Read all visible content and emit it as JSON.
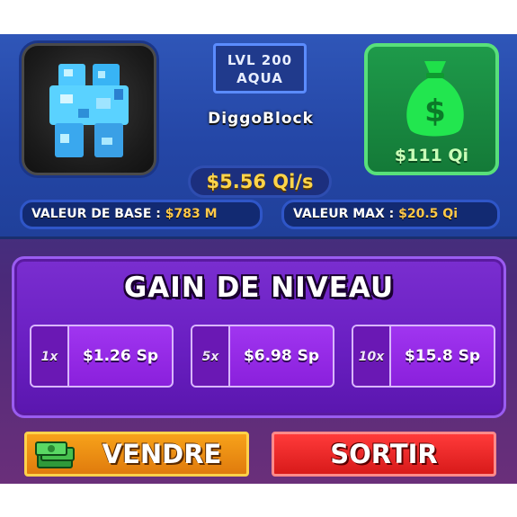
{
  "item": {
    "level": "LVL 200",
    "variant": "AQUA",
    "name": "DiggoBlock",
    "rate": "$5.56 Qi/s",
    "icon": "diamond-block-creature-icon"
  },
  "cash": {
    "amount": "$111 Qi",
    "icon": "money-bag-icon",
    "color": "#1e9a4a"
  },
  "stats": {
    "base_label": "VALEUR DE BASE :",
    "base_value": "$783 M",
    "max_label": "VALEUR MAX :",
    "max_value": "$20.5 Qi"
  },
  "upgrade": {
    "title": "GAIN DE NIVEAU",
    "options": [
      {
        "multiplier": "1x",
        "price": "$1.26 Sp"
      },
      {
        "multiplier": "5x",
        "price": "$6.98 Sp"
      },
      {
        "multiplier": "10x",
        "price": "$15.8 Sp"
      }
    ]
  },
  "actions": {
    "sell_label": "VENDRE",
    "sell_icon": "cash-stack-icon",
    "exit_label": "SORTIR",
    "sell_color": "#f7a21a",
    "exit_color": "#ff3a3a"
  }
}
